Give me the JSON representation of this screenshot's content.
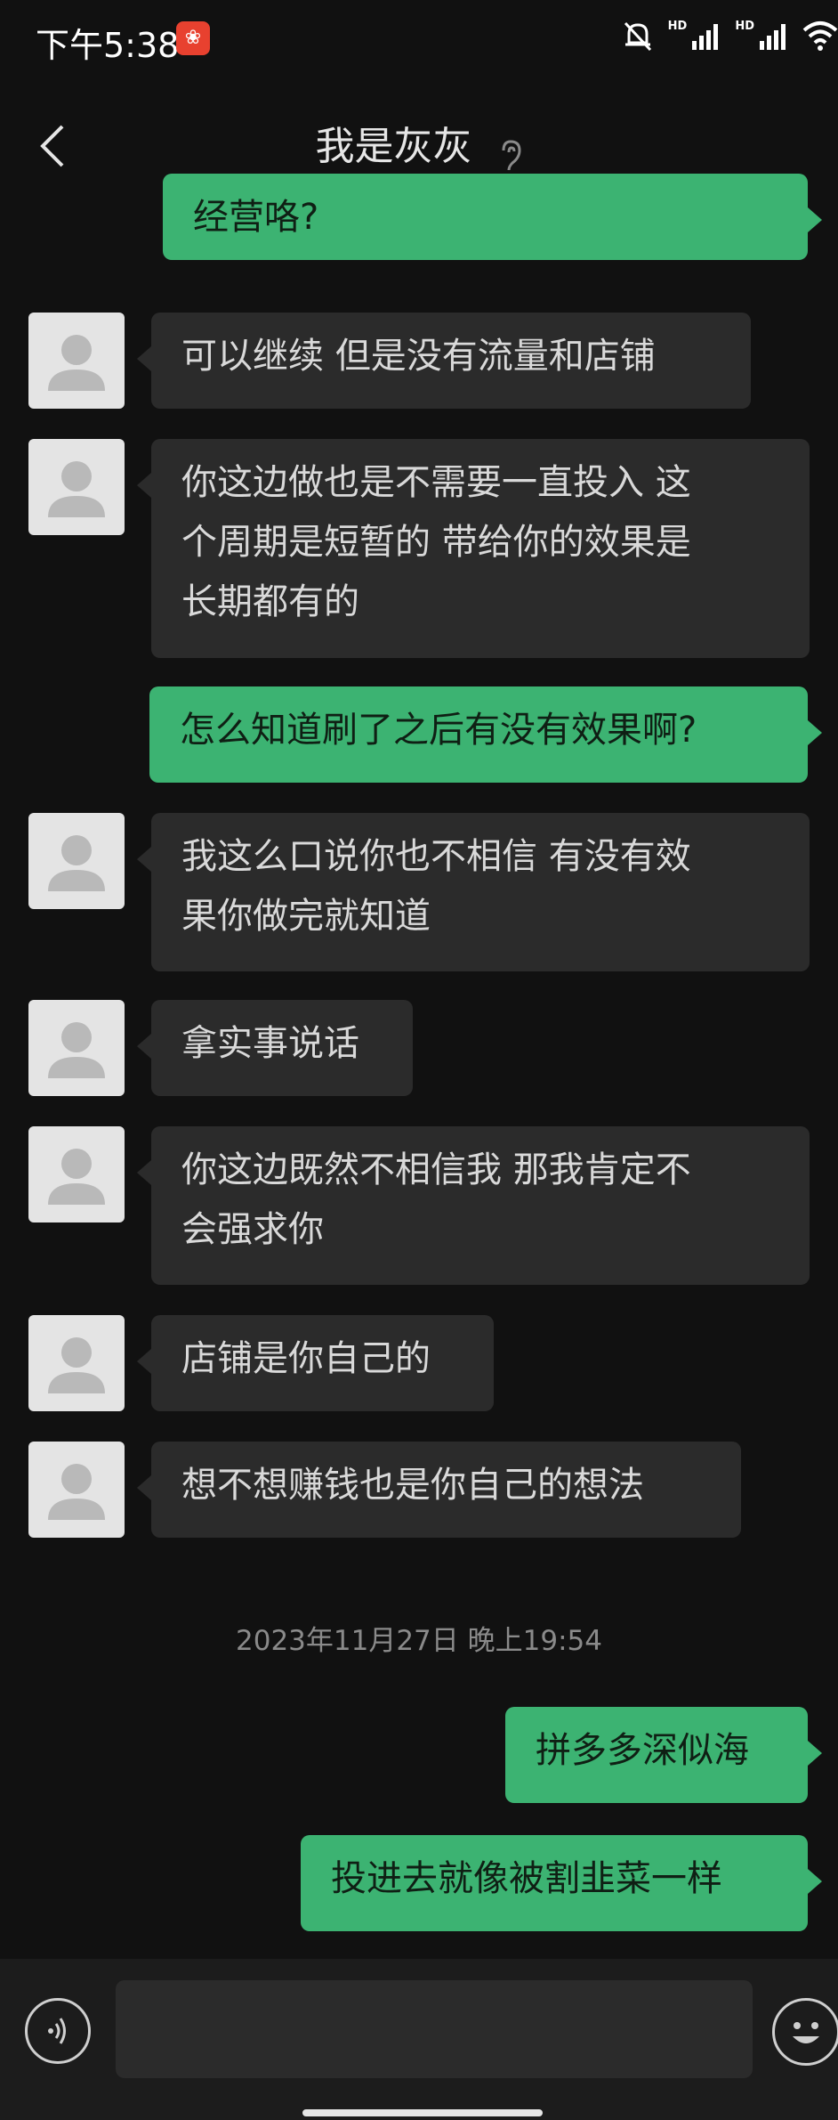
{
  "status": {
    "time": "下午5:38",
    "hd1": "HD",
    "hd2": "HD"
  },
  "header": {
    "title": "我是灰灰"
  },
  "messages": [
    {
      "side": "out",
      "lines": [
        "经营咯?"
      ]
    },
    {
      "side": "in",
      "lines": [
        "可以继续 但是没有流量和店铺"
      ]
    },
    {
      "side": "in",
      "lines": [
        "你这边做也是不需要一直投入 这",
        "个周期是短暂的  带给你的效果是",
        "长期都有的"
      ]
    },
    {
      "side": "out",
      "lines": [
        "怎么知道刷了之后有没有效果啊?"
      ]
    },
    {
      "side": "in",
      "lines": [
        "我这么口说你也不相信 有没有效",
        "果你做完就知道"
      ]
    },
    {
      "side": "in",
      "lines": [
        "拿实事说话"
      ]
    },
    {
      "side": "in",
      "lines": [
        "你这边既然不相信我 那我肯定不",
        "会强求你"
      ]
    },
    {
      "side": "in",
      "lines": [
        "店铺是你自己的"
      ]
    },
    {
      "side": "in",
      "lines": [
        "想不想赚钱也是你自己的想法"
      ]
    },
    {
      "side": "time",
      "text": "2023年11月27日 晚上19:54"
    },
    {
      "side": "out",
      "lines": [
        "拼多多深似海"
      ]
    },
    {
      "side": "out",
      "lines": [
        "投进去就像被割韭菜一样"
      ]
    }
  ],
  "composer": {
    "input_value": ""
  }
}
